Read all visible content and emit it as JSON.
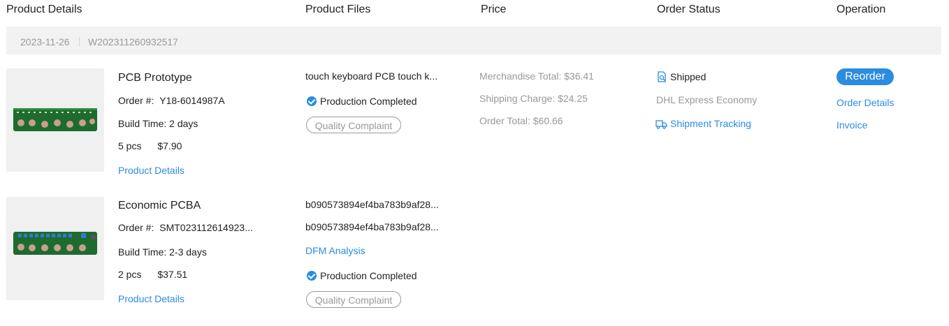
{
  "header": {
    "product_details": "Product Details",
    "product_files": "Product Files",
    "price": "Price",
    "order_status": "Order Status",
    "operation": "Operation"
  },
  "order_group": {
    "date": "2023-11-26",
    "order_number": "W202311260932517"
  },
  "items": [
    {
      "title": "PCB Prototype",
      "order_label": "Order #:",
      "order_no": "Y18-6014987A",
      "build_time": "Build Time: 2 days",
      "qty": "5 pcs",
      "price": "$7.90",
      "details_link": "Product Details",
      "file_name": "touch keyboard  PCB  touch k...",
      "production_status": "Production Completed",
      "complaint": "Quality Complaint"
    },
    {
      "title": "Economic PCBA",
      "order_label": "Order #:",
      "order_no": "SMT023112614923...",
      "build_time": "Build Time: 2-3 days",
      "qty": "2 pcs",
      "price": "$37.51",
      "details_link": "Product Details",
      "file_1": "b090573894ef4ba783b9af28...",
      "file_2": "b090573894ef4ba783b9af28...",
      "dfm": "DFM Analysis",
      "production_status": "Production Completed",
      "complaint": "Quality Complaint"
    }
  ],
  "price": {
    "merchandise": "Merchandise Total: $36.41",
    "shipping": "Shipping Charge: $24.25",
    "total": "Order Total: $60.66"
  },
  "status": {
    "state": "Shipped",
    "carrier": "DHL Express Economy",
    "tracking": "Shipment Tracking"
  },
  "operation": {
    "reorder": "Reorder",
    "order_details": "Order Details",
    "invoice": "Invoice"
  },
  "icons": {
    "doc_search": "document-search-icon",
    "truck": "truck-icon",
    "check": "check-circle-icon"
  },
  "colors": {
    "accent": "#2b8ce0",
    "muted": "#999999",
    "pcb_green": "#1e6b2f"
  }
}
